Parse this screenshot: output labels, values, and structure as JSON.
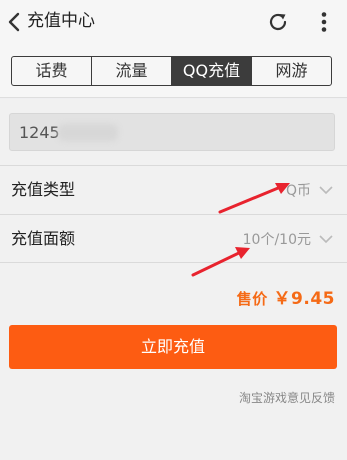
{
  "header": {
    "title": "充值中心"
  },
  "tabs": [
    {
      "label": "话费",
      "active": false
    },
    {
      "label": "流量",
      "active": false
    },
    {
      "label": "QQ充值",
      "active": true
    },
    {
      "label": "网游",
      "active": false
    }
  ],
  "form": {
    "account_value": "1245",
    "type_row": {
      "label": "充值类型",
      "value": "Q币"
    },
    "amount_row": {
      "label": "充值面额",
      "value": "10个/10元"
    }
  },
  "price": {
    "label": "售价",
    "amount": "￥9.45"
  },
  "buy_button": {
    "label": "立即充值"
  },
  "feedback_link": {
    "label": "淘宝游戏意见反馈"
  },
  "colors": {
    "accent": "#fd5c12",
    "price": "#f56a16",
    "annotation_arrow": "#e8232e"
  },
  "icons": [
    "back-chevron-icon",
    "refresh-icon",
    "more-vertical-icon",
    "chevron-down-icon"
  ]
}
